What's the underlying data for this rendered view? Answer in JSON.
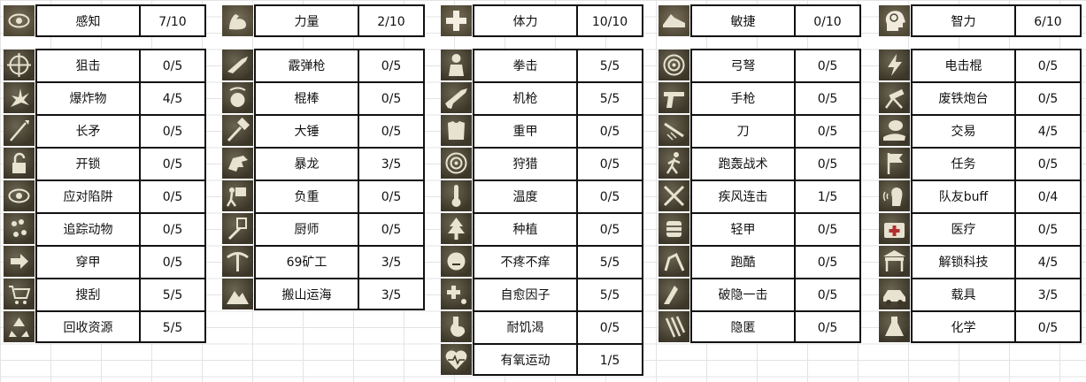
{
  "groups": [
    {
      "header": {
        "name": "感知",
        "value": "7/10",
        "icon": "eye-icon"
      },
      "skills": [
        {
          "name": "狙击",
          "value": "0/5",
          "icon": "crosshair-icon"
        },
        {
          "name": "爆炸物",
          "value": "4/5",
          "icon": "explosion-icon"
        },
        {
          "name": "长矛",
          "value": "0/5",
          "icon": "spear-icon"
        },
        {
          "name": "开锁",
          "value": "0/5",
          "icon": "padlock-icon"
        },
        {
          "name": "应对陷阱",
          "value": "0/5",
          "icon": "eye-icon"
        },
        {
          "name": "追踪动物",
          "value": "0/5",
          "icon": "paw-prints-icon"
        },
        {
          "name": "穿甲",
          "value": "0/5",
          "icon": "arrow-right-icon"
        },
        {
          "name": "搜刮",
          "value": "5/5",
          "icon": "shopping-cart-icon"
        },
        {
          "name": "回收资源",
          "value": "5/5",
          "icon": "recycle-icon"
        }
      ]
    },
    {
      "header": {
        "name": "力量",
        "value": "2/10",
        "icon": "flexed-arm-icon"
      },
      "skills": [
        {
          "name": "霰弹枪",
          "value": "0/5",
          "icon": "shotgun-icon"
        },
        {
          "name": "棍棒",
          "value": "0/5",
          "icon": "dizzy-head-icon"
        },
        {
          "name": "大锤",
          "value": "0/5",
          "icon": "sledgehammer-icon"
        },
        {
          "name": "暴龙",
          "value": "3/5",
          "icon": "dinosaur-icon"
        },
        {
          "name": "负重",
          "value": "0/5",
          "icon": "carrying-box-icon"
        },
        {
          "name": "厨师",
          "value": "0/5",
          "icon": "spatula-icon"
        },
        {
          "name": "69矿工",
          "value": "3/5",
          "icon": "pickaxe-icon"
        },
        {
          "name": "搬山运海",
          "value": "3/5",
          "icon": "mountain-move-icon"
        }
      ]
    },
    {
      "header": {
        "name": "体力",
        "value": "10/10",
        "icon": "health-cross-icon"
      },
      "skills": [
        {
          "name": "拳击",
          "value": "5/5",
          "icon": "boxer-icon"
        },
        {
          "name": "机枪",
          "value": "5/5",
          "icon": "rifle-icon"
        },
        {
          "name": "重甲",
          "value": "0/5",
          "icon": "heavy-armor-icon"
        },
        {
          "name": "狩猎",
          "value": "0/5",
          "icon": "target-icon"
        },
        {
          "name": "温度",
          "value": "0/5",
          "icon": "thermometer-icon"
        },
        {
          "name": "种植",
          "value": "0/5",
          "icon": "pine-tree-icon"
        },
        {
          "name": "不疼不痒",
          "value": "5/5",
          "icon": "calm-face-icon"
        },
        {
          "name": "自愈因子",
          "value": "5/5",
          "icon": "healing-plus-icon"
        },
        {
          "name": "耐饥渴",
          "value": "0/5",
          "icon": "stomach-icon"
        },
        {
          "name": "有氧运动",
          "value": "1/5",
          "icon": "heartbeat-icon"
        }
      ]
    },
    {
      "header": {
        "name": "敏捷",
        "value": "0/10",
        "icon": "running-shoe-icon"
      },
      "skills": [
        {
          "name": "弓弩",
          "value": "0/5",
          "icon": "target-icon"
        },
        {
          "name": "手枪",
          "value": "0/5",
          "icon": "revolver-icon"
        },
        {
          "name": "刀",
          "value": "0/5",
          "icon": "knife-slash-icon"
        },
        {
          "name": "跑轰战术",
          "value": "0/5",
          "icon": "running-man-icon"
        },
        {
          "name": "疾风连击",
          "value": "1/5",
          "icon": "crossed-swords-icon"
        },
        {
          "name": "轻甲",
          "value": "0/5",
          "icon": "light-armor-icon"
        },
        {
          "name": "跑酷",
          "value": "0/5",
          "icon": "parkour-icon"
        },
        {
          "name": "破隐一击",
          "value": "0/5",
          "icon": "stealth-strike-icon"
        },
        {
          "name": "隐匿",
          "value": "0/5",
          "icon": "claw-marks-icon"
        }
      ]
    },
    {
      "header": {
        "name": "智力",
        "value": "6/10",
        "icon": "brain-head-icon"
      },
      "skills": [
        {
          "name": "电击棍",
          "value": "0/5",
          "icon": "lightning-icon"
        },
        {
          "name": "废铁炮台",
          "value": "0/5",
          "icon": "turret-icon"
        },
        {
          "name": "交易",
          "value": "4/5",
          "icon": "money-hand-icon"
        },
        {
          "name": "任务",
          "value": "0/5",
          "icon": "quest-flag-icon"
        },
        {
          "name": "队友buff",
          "value": "0/4",
          "icon": "ally-voice-icon"
        },
        {
          "name": "医疗",
          "value": "0/5",
          "icon": "medkit-icon"
        },
        {
          "name": "解锁科技",
          "value": "4/5",
          "icon": "workbench-icon"
        },
        {
          "name": "载具",
          "value": "3/5",
          "icon": "vehicle-icon"
        },
        {
          "name": "化学",
          "value": "0/5",
          "icon": "flask-icon"
        }
      ]
    }
  ]
}
